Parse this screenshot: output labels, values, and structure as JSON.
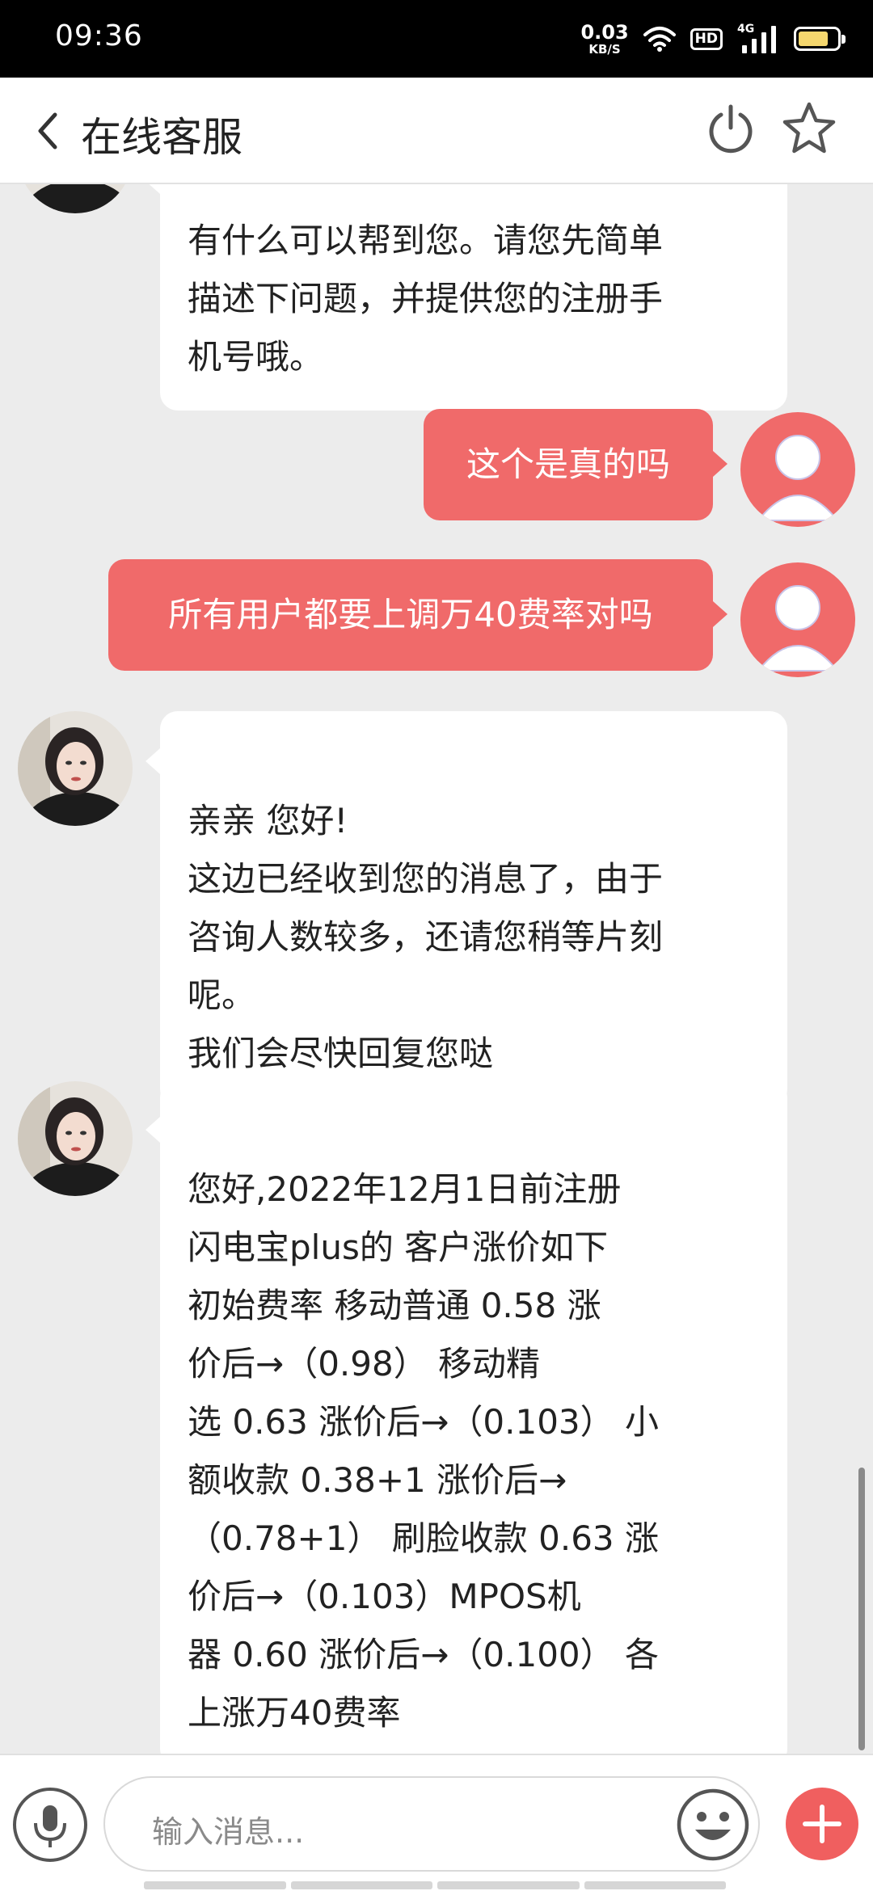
{
  "status_bar": {
    "time": "09:36",
    "net_speed_value": "0.03",
    "net_speed_unit": "KB/S",
    "hd_badge": "HD",
    "network_type": "4G",
    "battery_color": "#f5d76e"
  },
  "header": {
    "title": "在线客服",
    "back_icon": "chevron-left-icon",
    "power_icon": "power-icon",
    "star_icon": "star-outline-icon"
  },
  "messages": [
    {
      "sender": "agent",
      "text": "有什么可以帮到您。请您先简单\n描述下问题，并提供您的注册手\n机号哦。"
    },
    {
      "sender": "user",
      "text": "这个是真的吗"
    },
    {
      "sender": "user",
      "text": "所有用户都要上调万40费率对吗"
    },
    {
      "sender": "agent",
      "text": "亲亲 您好!\n这边已经收到您的消息了，由于\n咨询人数较多，还请您稍等片刻\n呢。\n我们会尽快回复您哒"
    },
    {
      "sender": "agent",
      "text": "您好,2022年12月1日前注册\n闪电宝plus的 客户涨价如下\n初始费率 移动普通 0.58   涨\n价后→（0.98）  移动精\n选 0.63   涨价后→（0.103）  小\n额收款 0.38+1   涨价后→\n（0.78+1）  刷脸收款 0.63   涨\n价后→（0.103）MPOS机\n器  0.60  涨价后→（0.100）   各\n上涨万40费率"
    }
  ],
  "input_bar": {
    "placeholder": "输入消息...",
    "mic_icon": "microphone-icon",
    "emoji_icon": "emoji-icon",
    "plus_icon": "plus-icon"
  },
  "colors": {
    "accent": "#f06a6a",
    "chat_background": "#ececec",
    "bubble_in": "#ffffff"
  }
}
